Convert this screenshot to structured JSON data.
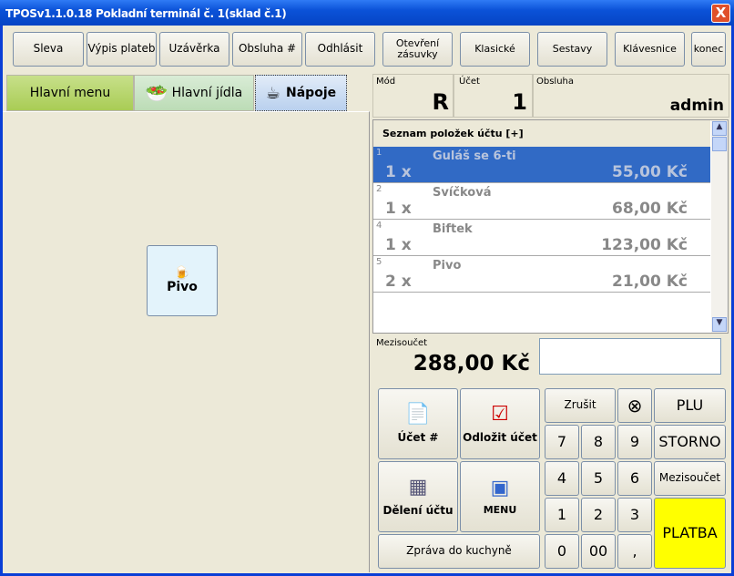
{
  "window": {
    "title": "TPOSv1.1.0.18 Pokladní terminál č. 1(sklad č.1)",
    "close": "X"
  },
  "toolbar": [
    "Sleva",
    "Výpis plateb",
    "Uzávěrka",
    "Obsluha #",
    "Odhlásit",
    "Otevření zásuvky",
    "Klasické",
    "Sestavy",
    "Klávesnice",
    "konec"
  ],
  "tabs": [
    {
      "label": "Hlavní menu"
    },
    {
      "label": "Hlavní jídla"
    },
    {
      "label": "Nápoje"
    }
  ],
  "products": [
    {
      "label": "Pivo"
    }
  ],
  "status": {
    "mode_label": "Mód",
    "mode": "R",
    "account_label": "Účet",
    "account": "1",
    "staff_label": "Obsluha",
    "staff": "admin"
  },
  "list": {
    "header": "Seznam položek účtu [+]",
    "items": [
      {
        "no": "1",
        "name": "Guláš se 6-ti",
        "qty": "1 x",
        "price": "55,00 Kč"
      },
      {
        "no": "2",
        "name": "Svíčková",
        "qty": "1 x",
        "price": "68,00 Kč"
      },
      {
        "no": "4",
        "name": "Biftek",
        "qty": "1 x",
        "price": "123,00 Kč"
      },
      {
        "no": "5",
        "name": "Pivo",
        "qty": "2 x",
        "price": "21,00 Kč"
      }
    ]
  },
  "subtotal": {
    "label": "Mezisoučet",
    "value": "288,00 Kč"
  },
  "actions": {
    "account": "Účet #",
    "postpone": "Odložit účet",
    "split": "Dělení účtu",
    "menu": "MENU",
    "kitchen": "Zpráva do kuchyně"
  },
  "keypad": {
    "cancel": "Zrušit",
    "clear": "⊗",
    "plu": "PLU",
    "storno": "STORNO",
    "subtotal": "Mezisoučet",
    "pay": "PLATBA",
    "keys": [
      "7",
      "8",
      "9",
      "4",
      "5",
      "6",
      "1",
      "2",
      "3",
      "0",
      "00",
      ","
    ]
  }
}
